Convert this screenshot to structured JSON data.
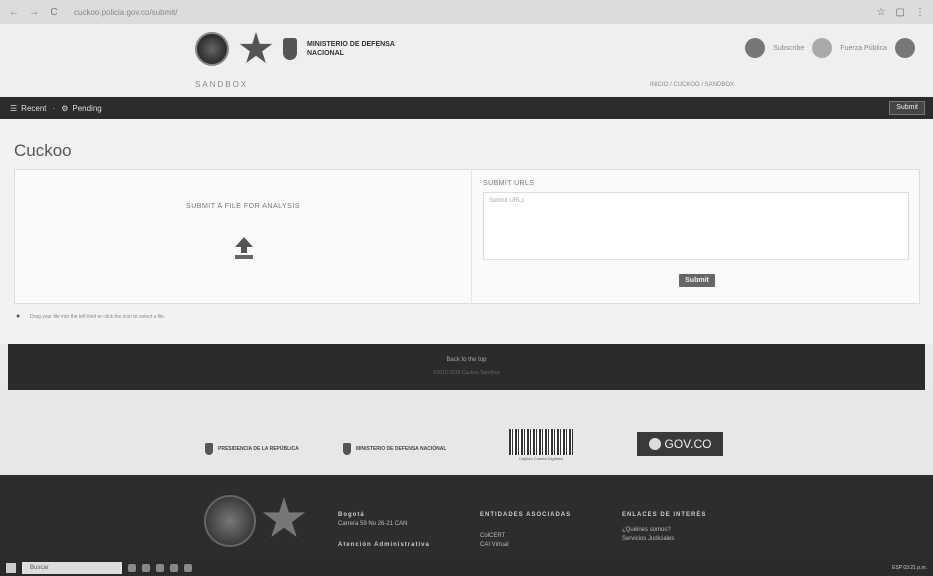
{
  "browser": {
    "url": "cuckoo.policia.gov.co/submit/",
    "back_icon": "arrow-left",
    "forward_icon": "arrow-right",
    "reload_icon": "reload"
  },
  "header": {
    "ministry": "MINISTERIO DE DEFENSA NACIONAL",
    "sandbox": "SANDBOX",
    "user1": "Subscribe",
    "user2": "Fuerza Pública",
    "breadcrumb": "INICIO / CUCKOO / SANDBOX"
  },
  "nav": {
    "recent": "Recent",
    "pending": "Pending",
    "submit": "Submit"
  },
  "main": {
    "title": "Cuckoo",
    "upload_title": "SUBMIT A FILE FOR ANALYSIS",
    "urls_title": "SUBMIT URLS",
    "urls_placeholder": "Submit URLs",
    "submit": "Submit",
    "hint": "Drag your file into the left field or click the icon to select a file."
  },
  "band": {
    "back_to_top": "Back to the top",
    "powered": "©2010-2018 Cuckoo Sandbox"
  },
  "logos": {
    "presidency": "PRESIDENCIA DE LA REPÚBLICA",
    "ministry": "MINISTERIO DE DEFENSA NACIONAL",
    "barcode_caption": "Capitán Cuenta Digitales",
    "govco": "GOV.CO"
  },
  "footer": {
    "city": "Bogotá",
    "address": "Carrera 59 No 26-21 CAN",
    "attention": "Atención Administrativa",
    "entities_head": "ENTIDADES ASOCIADAS",
    "entity1": "ColCERT",
    "entity2": "CAI Virtual",
    "links_head": "ENLACES DE INTERÉS",
    "link1": "¿Quiénes somos?",
    "link2": "Servicios Judiciales"
  },
  "taskbar": {
    "search": "Buscar",
    "tray": "ESP 03:21 p.m."
  }
}
